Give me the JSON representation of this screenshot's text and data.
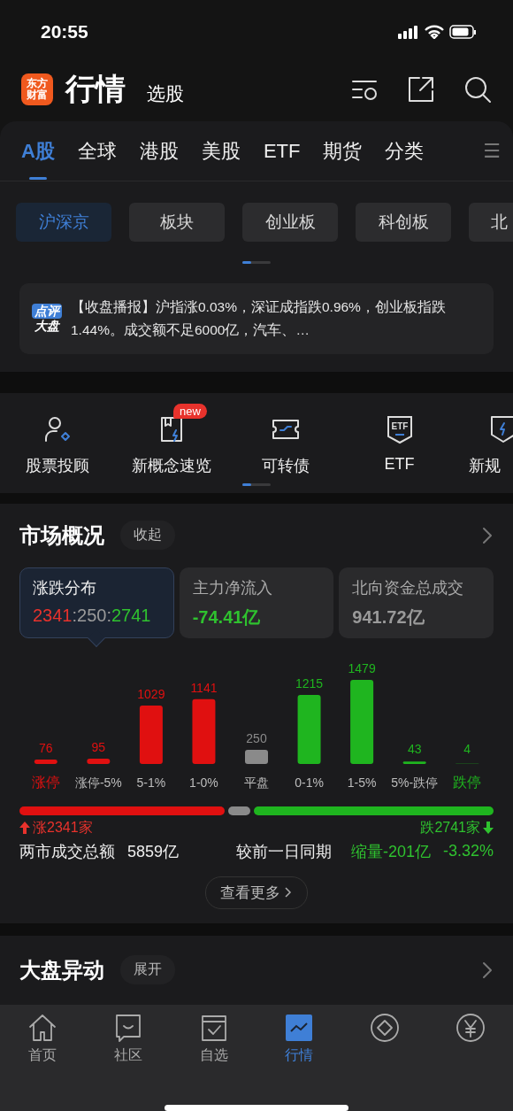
{
  "status_bar": {
    "time": "20:55"
  },
  "header": {
    "logo_lines": [
      "东方",
      "财富"
    ],
    "title": "行情",
    "subtitle": "选股"
  },
  "market_tabs": [
    {
      "label": "A股",
      "selected": true
    },
    {
      "label": "全球",
      "selected": false
    },
    {
      "label": "港股",
      "selected": false
    },
    {
      "label": "美股",
      "selected": false
    },
    {
      "label": "ETF",
      "selected": false
    },
    {
      "label": "期货",
      "selected": false
    },
    {
      "label": "分类",
      "selected": false
    }
  ],
  "menu_glyph": "☰",
  "chips": [
    {
      "label": "沪深京",
      "selected": true
    },
    {
      "label": "板块",
      "selected": false
    },
    {
      "label": "创业板",
      "selected": false
    },
    {
      "label": "科创板",
      "selected": false
    },
    {
      "label": "北",
      "selected": false
    }
  ],
  "news": {
    "badge_lines": [
      "点评",
      "大盘"
    ],
    "text": "【收盘播报】沪指涨0.03%，深证成指跌0.96%，创业板指跌1.44%。成交额不足6000亿，汽车、…"
  },
  "shortcuts": [
    {
      "kind": "advisor",
      "label": "股票投顾"
    },
    {
      "kind": "concept",
      "label": "新概念速览",
      "badge": "new"
    },
    {
      "kind": "bond",
      "label": "可转债"
    },
    {
      "kind": "etf",
      "label": "ETF",
      "icon_text": "ETF"
    },
    {
      "kind": "shield",
      "label": "新规"
    }
  ],
  "market_overview": {
    "title": "市场概况",
    "toggle": "收起",
    "cards": [
      {
        "label": "涨跌分布",
        "selected": true,
        "parts": [
          {
            "text": "2341",
            "color": "#e8322c"
          },
          {
            "text": ":250:",
            "color": "#9a9a9a"
          },
          {
            "text": "2741",
            "color": "#2fc22f"
          }
        ]
      },
      {
        "label": "主力净流入",
        "selected": false,
        "parts": [
          {
            "text": "-74.41亿",
            "color": "#2fc22f"
          }
        ]
      },
      {
        "label": "北向资金总成交",
        "selected": false,
        "parts": [
          {
            "text": "941.72亿",
            "color": "#9a9a9a"
          }
        ]
      }
    ],
    "distribution": {
      "chart_data": {
        "type": "bar",
        "categories": [
          "涨停",
          "涨停-5%",
          "5-1%",
          "1-0%",
          "平盘",
          "0-1%",
          "1-5%",
          "5%-跌停",
          "跌停"
        ],
        "series": [
          {
            "color": "#e01010",
            "values": [
              76,
              95,
              1029,
              1141,
              null,
              null,
              null,
              null,
              null
            ]
          },
          {
            "color": "#8a8a8a",
            "values": [
              null,
              null,
              null,
              null,
              250,
              null,
              null,
              null,
              null
            ]
          },
          {
            "color": "#1fb51f",
            "values": [
              null,
              null,
              null,
              null,
              null,
              1215,
              1479,
              43,
              4
            ]
          }
        ],
        "data_labels": true
      }
    },
    "up_count": "涨2341家",
    "down_count": "跌2741家",
    "turnover_label": "两市成交总额",
    "turnover_value": "5859亿",
    "compare_label": "较前一日同期",
    "compare_change": "缩量-201亿",
    "compare_pct": "-3.32%",
    "more_button": "查看更多"
  },
  "index_moves": {
    "title": "大盘异动",
    "toggle": "展开"
  },
  "bottom_tabs": [
    {
      "kind": "home",
      "label": "首页",
      "selected": false
    },
    {
      "kind": "community",
      "label": "社区",
      "selected": false
    },
    {
      "kind": "watchlist",
      "label": "自选",
      "selected": false
    },
    {
      "kind": "market",
      "label": "行情",
      "selected": true
    },
    {
      "kind": "diamond",
      "selected": false
    },
    {
      "kind": "yen",
      "selected": false
    }
  ]
}
